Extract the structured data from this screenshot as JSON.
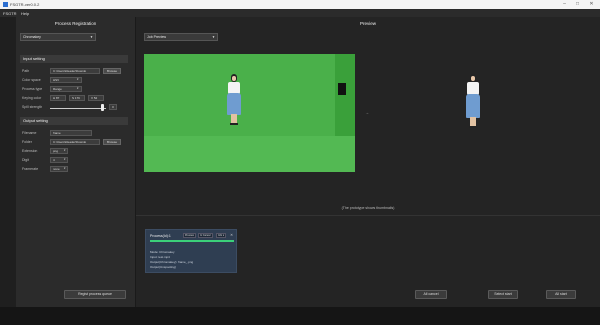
{
  "titlebar": {
    "title": "FSGTR-ver0.0.2",
    "minimize_glyph": "–",
    "maximize_glyph": "□",
    "close_glyph": "✕"
  },
  "menubar": {
    "items": [
      "FSGTR",
      "Help"
    ]
  },
  "sidebar": {
    "heading": "Process Registration",
    "process_select": "Chromakey",
    "input_setting": {
      "header": "Input setting",
      "path_label": "Path",
      "path_value": "C:\\Users\\Reader\\Downlo",
      "browse_label": "Browse",
      "color_space_label": "Color space",
      "color_space_value": "HSV",
      "process_type_label": "Process type",
      "process_type_value": "Range",
      "keying_color_label": "Keying color",
      "keying_values": [
        "H 87",
        "S 179",
        "V 52"
      ],
      "spill_strength_label": "Spill strength",
      "spill_strength_value": "0",
      "spill_strength_level": 0.93
    },
    "output_setting": {
      "header": "Output setting",
      "filename_label": "Filename",
      "filename_value": "frame",
      "folder_label": "Folder",
      "folder_value": "C:\\Users\\Reader\\Downlo",
      "browse_label": "Browse",
      "extension_label": "Extension",
      "extension_value": "png",
      "digit_label": "Digit",
      "digit_value": "4",
      "framerate_label": "Framerate",
      "framerate_value": "none"
    },
    "regist_button": "Regist process queue"
  },
  "main": {
    "heading": "Preview",
    "preview_select": "Job Preview",
    "prototype_note": "(The prototype shows thumbnails)",
    "arrow": "→",
    "task_card": {
      "title": "Process(Id):1",
      "btn_prev": "Preview",
      "btn_cancel": "In Cancel",
      "btn_info": "Info ▾",
      "close": "✕",
      "progress": 1.0,
      "lines": [
        "Mode: Chromakey",
        "Input: test.mp4",
        "Output(Chromakey): frame_.png",
        "Output(Unspooling)"
      ]
    },
    "buttons": {
      "all_cancel": "All cancel",
      "select_start": "Select start",
      "all_start": "All start"
    }
  },
  "colors": {
    "green_screen": "#4ab04a",
    "progress": "#3bd07a",
    "task_card": "#2f3e52",
    "skirt": "#6f9cd0"
  }
}
